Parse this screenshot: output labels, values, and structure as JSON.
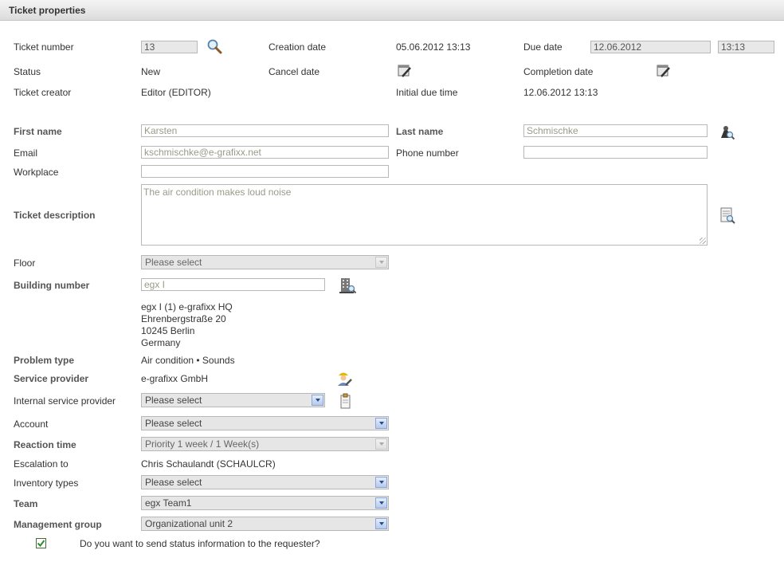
{
  "header": {
    "title": "Ticket properties"
  },
  "ticket": {
    "number_label": "Ticket number",
    "number_value": "13",
    "creation_label": "Creation date",
    "creation_value": "05.06.2012 13:13",
    "due_label": "Due date",
    "due_date_value": "12.06.2012",
    "due_time_value": "13:13",
    "status_label": "Status",
    "status_value": "New",
    "cancel_label": "Cancel date",
    "completion_label": "Completion date",
    "creator_label": "Ticket creator",
    "creator_value": "Editor (EDITOR)",
    "initial_due_label": "Initial due time",
    "initial_due_value": "12.06.2012 13:13"
  },
  "contact": {
    "first_name_label": "First name",
    "first_name_value": "Karsten",
    "last_name_label": "Last name",
    "last_name_value": "Schmischke",
    "email_label": "Email",
    "email_value": "kschmischke@e-grafixx.net",
    "phone_label": "Phone number",
    "phone_value": "",
    "workplace_label": "Workplace",
    "workplace_value": ""
  },
  "description": {
    "label": "Ticket description",
    "value": "The air condition makes loud noise"
  },
  "location": {
    "floor_label": "Floor",
    "floor_value": "Please select",
    "building_label": "Building number",
    "building_value": "egx I",
    "address_line1": "egx I (1) e-grafixx HQ",
    "address_line2": "Ehrenbergstraße 20",
    "address_line3": "10245 Berlin",
    "address_line4": "Germany"
  },
  "service": {
    "problem_label": "Problem type",
    "problem_value": "Air condition • Sounds",
    "provider_label": "Service provider",
    "provider_value": "e-grafixx GmbH",
    "internal_label": "Internal service provider",
    "internal_value": "Please select",
    "account_label": "Account",
    "account_value": "Please select",
    "reaction_label": "Reaction time",
    "reaction_value": "Priority 1 week / 1 Week(s)",
    "escalation_label": "Escalation to",
    "escalation_value": "Chris Schaulandt (SCHAULCR)",
    "inventory_label": "Inventory types",
    "inventory_value": "Please select",
    "team_label": "Team",
    "team_value": "egx Team1",
    "mgmt_label": "Management group",
    "mgmt_value": "Organizational unit 2"
  },
  "notify": {
    "label": "Do you want to send status information to the requester?",
    "checked": true
  },
  "colors": {
    "header_bg": "#dcdcdc",
    "select_arrow": "#b6c9ec",
    "check_green": "#2e8b2e"
  },
  "icons": [
    "search-icon",
    "calendar-edit-icon",
    "calendar-edit-icon",
    "person-search-icon",
    "document-search-icon",
    "building-search-icon",
    "worker-icon",
    "clipboard-icon"
  ]
}
